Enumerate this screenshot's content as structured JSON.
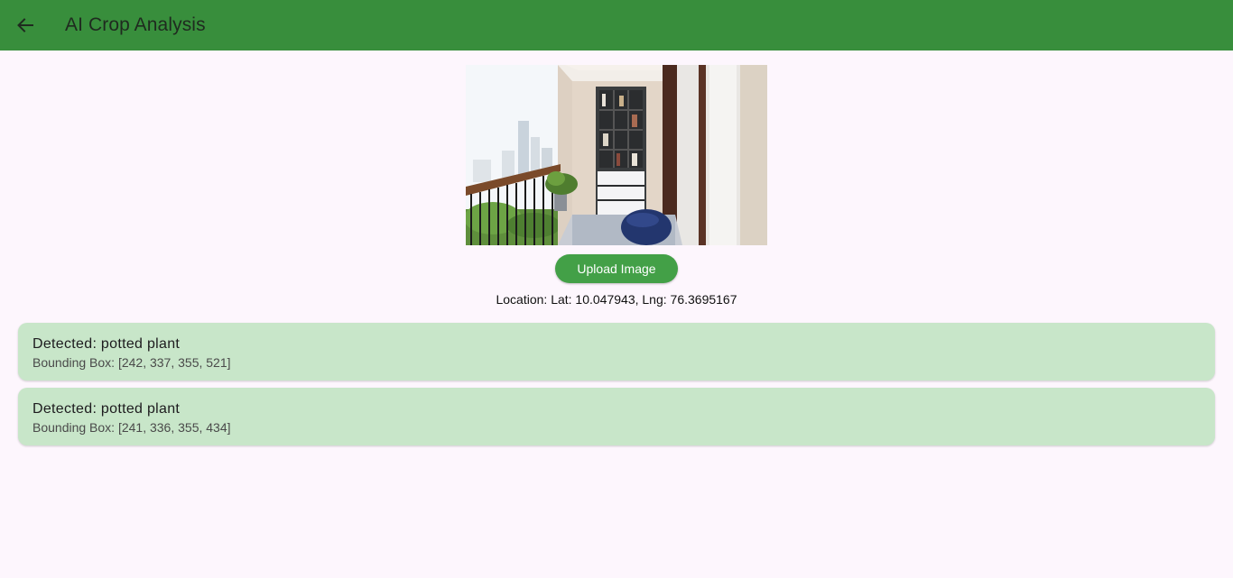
{
  "app_bar": {
    "title": "AI Crop Analysis",
    "back_icon": "arrow-back-icon",
    "color": "#388e3c"
  },
  "main": {
    "image_description_icon": "balcony-photo",
    "upload_button_label": "Upload Image",
    "location_text": "Location: Lat: 10.047943, Lng: 76.3695167",
    "accent_color": "#43a047",
    "results": [
      {
        "title": "Detected: potted plant",
        "subtitle": "Bounding Box: [242, 337, 355, 521]"
      },
      {
        "title": "Detected: potted plant",
        "subtitle": "Bounding Box: [241, 336, 355, 434]"
      }
    ],
    "card_color": "#c8e6c9"
  }
}
